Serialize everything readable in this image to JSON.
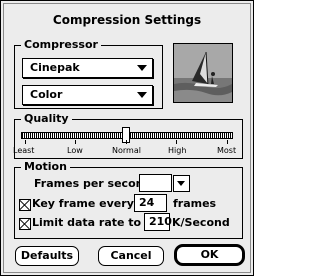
{
  "dialog": {
    "title": "Compression Settings"
  },
  "compressor": {
    "label": "Compressor",
    "codec": "Cinepak",
    "depth": "Color"
  },
  "quality": {
    "label": "Quality",
    "levels": [
      "Least",
      "Low",
      "Normal",
      "High",
      "Most"
    ],
    "value": 0.5
  },
  "motion": {
    "label": "Motion",
    "fps_label": "Frames per second:",
    "fps_value": "",
    "keyframe_label": "Key frame every",
    "keyframe_value": "24",
    "keyframe_unit": "frames",
    "keyframe_checked": true,
    "limit_label": "Limit data rate to",
    "limit_value": "210",
    "limit_unit": "K/Second",
    "limit_checked": true
  },
  "buttons": {
    "defaults": "Defaults",
    "cancel": "Cancel",
    "ok": "OK"
  }
}
